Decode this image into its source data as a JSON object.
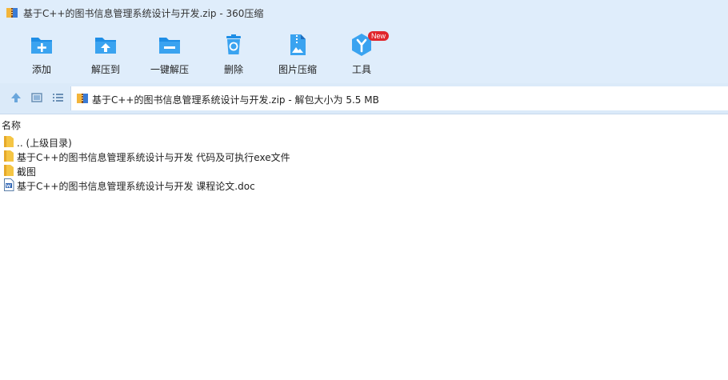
{
  "window": {
    "title": "基于C++的图书信息管理系统设计与开发.zip - 360压缩"
  },
  "toolbar": {
    "items": [
      {
        "label": "添加",
        "icon": "add-icon"
      },
      {
        "label": "解压到",
        "icon": "extract-to-icon"
      },
      {
        "label": "一键解压",
        "icon": "one-click-extract-icon"
      },
      {
        "label": "删除",
        "icon": "delete-icon"
      },
      {
        "label": "图片压缩",
        "icon": "image-compress-icon"
      },
      {
        "label": "工具",
        "icon": "tools-icon",
        "badge": "New"
      }
    ]
  },
  "address": {
    "text": "基于C++的图书信息管理系统设计与开发.zip - 解包大小为 5.5 MB"
  },
  "list": {
    "column_name": "名称",
    "rows": [
      {
        "name": ".. (上级目录)",
        "type": "folder"
      },
      {
        "name": "基于C++的图书信息管理系统设计与开发 代码及可执行exe文件",
        "type": "folder"
      },
      {
        "name": "截图",
        "type": "folder"
      },
      {
        "name": "基于C++的图书信息管理系统设计与开发 课程论文.doc",
        "type": "doc"
      }
    ]
  },
  "colors": {
    "accent": "#1e8ee6",
    "toolbar_bg": "#dfedfb",
    "folder": "#f5c544",
    "badge": "#e0262c"
  }
}
